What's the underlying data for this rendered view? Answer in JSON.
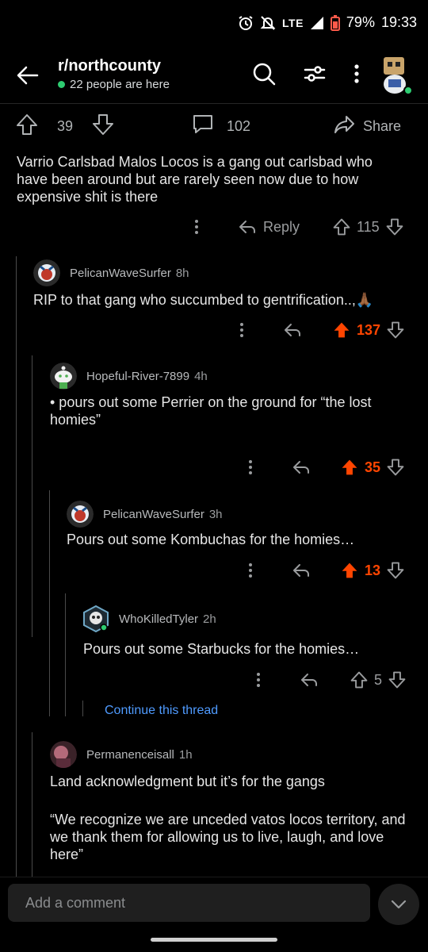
{
  "status_bar": {
    "network": "LTE",
    "battery": "79%",
    "time": "19:33"
  },
  "header": {
    "subreddit": "r/northcounty",
    "online": "22 people are here"
  },
  "post_bar": {
    "upvotes": "39",
    "comments": "102",
    "share_label": "Share"
  },
  "comments": [
    {
      "text": "Varrio Carlsbad Malos Locos is a gang out carlsbad who have been around but are rarely seen now due to how expensive shit is there",
      "reply_label": "Reply",
      "score": "115"
    },
    {
      "author": "PelicanWaveSurfer",
      "age": "8h",
      "text": "RIP to that gang who succumbed to gentrification..,🙏🏾",
      "score": "137"
    },
    {
      "author": "Hopeful-River-7899",
      "age": "4h",
      "text": "• pours out some Perrier on the ground for “the lost homies”",
      "score": "35"
    },
    {
      "author": "PelicanWaveSurfer",
      "age": "3h",
      "text": "Pours out some Kombuchas for the homies…",
      "score": "13"
    },
    {
      "author": "WhoKilledTyler",
      "age": "2h",
      "text": "Pours out some Starbucks for the homies…",
      "score": "5"
    },
    {
      "author": "Permanenceisall",
      "age": "1h",
      "text_1": "Land acknowledgment but it’s for the gangs",
      "text_2": "“We recognize we are unceded vatos locos territory, and we thank them for allowing us to live, laugh, and love here”"
    }
  ],
  "continue_thread": "Continue this thread",
  "bottom": {
    "comment_placeholder": "Add a comment"
  },
  "colors": {
    "accent_orange": "#ff4500",
    "link_blue": "#4f9bff",
    "online_green": "#2ecc71"
  }
}
